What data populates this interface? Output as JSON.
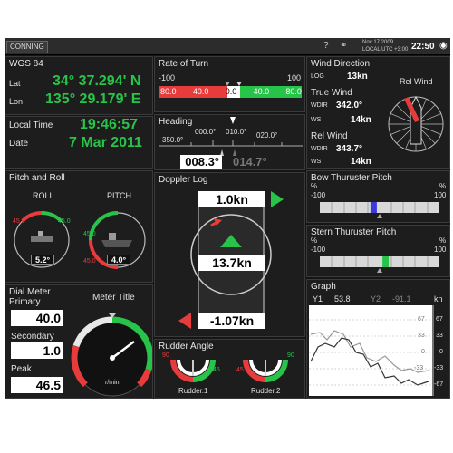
{
  "topbar": {
    "mode": "CONNING",
    "date": "Nov 17 2009",
    "tz": "LOCAL  UTC +3:00",
    "time": "22:50"
  },
  "position": {
    "title": "WGS 84",
    "lat_label": "Lat",
    "lat": "34° 37.294' N",
    "lon_label": "Lon",
    "lon": "135° 29.179' E"
  },
  "rot": {
    "title": "Rate of Turn",
    "min": "-100",
    "max": "100",
    "marks": [
      "80.0",
      "40.0",
      "0.0",
      "40.0",
      "80.0"
    ],
    "value": 20
  },
  "wind": {
    "title": "Wind Direction",
    "log_label": "LOG",
    "log": "13kn",
    "rel_title": "Rel Wind",
    "true_title": "True Wind",
    "wdir_label": "WDIR",
    "true_wdir": "342.0°",
    "ws_label": "WS",
    "true_ws": "14kn",
    "rel_label": "Rel Wind",
    "rel_wdir": "343.7°",
    "rel_ws": "14kn"
  },
  "time": {
    "local_label": "Local Time",
    "time": "19:46:57",
    "date_label": "Date",
    "date": "7 Mar 2011"
  },
  "heading": {
    "title": "Heading",
    "ticks": [
      "350.0°",
      "000.0°",
      "010.0°",
      "020.0°"
    ],
    "value": "008.3°",
    "set": "014.7°"
  },
  "pitchroll": {
    "title": "Pitch and Roll",
    "roll_label": "ROLL",
    "pitch_label": "PITCH",
    "roll_l": "45.0",
    "roll_r": "45.0",
    "pitch_l": "45.0",
    "pitch_r": "45.0",
    "roll": "5.2°",
    "pitch": "4.0°"
  },
  "doppler": {
    "title": "Doppler Log",
    "fwd": "1.0kn",
    "mid": "13.7kn",
    "aft": "-1.07kn"
  },
  "bow": {
    "title": "Bow Thuruster Pitch",
    "unit_l": "%",
    "unit_r": "%",
    "min": "-100",
    "max": "100",
    "value": -10
  },
  "stern": {
    "title": "Stern Thuruster Pitch",
    "unit_l": "%",
    "unit_r": "%",
    "min": "-100",
    "max": "100",
    "value": 10
  },
  "dial": {
    "title": "Dial Meter",
    "primary_label": "Primary",
    "primary": "40.0",
    "secondary_label": "Secondary",
    "secondary": "1.0",
    "peak_label": "Peak",
    "peak": "46.5",
    "meter_title": "Meter Title",
    "unit": "r/min"
  },
  "rudder": {
    "title": "Rudder Angle",
    "r1_label": "Rudder.1",
    "r2_label": "Rudder.2",
    "left_top": "90",
    "right_top": "90",
    "left_mid": "45",
    "right_mid": "45"
  },
  "graph": {
    "title": "Graph",
    "y1_label": "Y1",
    "y1": "53.8",
    "y2_label": "Y2",
    "y2": "-91.1",
    "unit": "kn",
    "ticks_in": [
      "67",
      "33",
      "0",
      "-33"
    ],
    "ticks_out": [
      "67",
      "33",
      "0",
      "-33",
      "-67"
    ]
  }
}
